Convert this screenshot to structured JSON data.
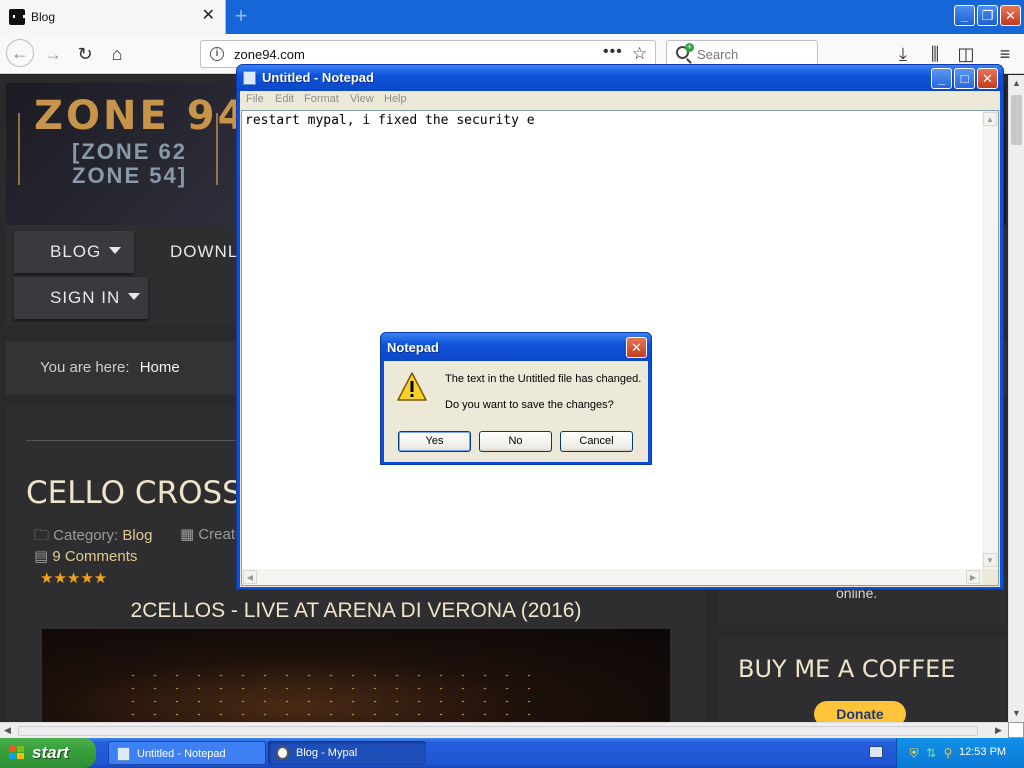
{
  "browser": {
    "tab_title": "Blog",
    "tab_close": "✕",
    "new_tab": "+",
    "url": "zone94.com",
    "url_actions": "•••",
    "search_placeholder": "Search",
    "window_buttons": {
      "minimize": "🗕",
      "restore": "🗗",
      "close": "✕"
    }
  },
  "site": {
    "logo": "ZONE 94",
    "logo_sub1": "[ZONE 62",
    "logo_sub2": "ZONE 54]",
    "nav": {
      "blog": "BLOG",
      "downloads": "DOWNLO",
      "signin": "SIGN IN"
    },
    "breadcrumb_prefix": "You are here:",
    "breadcrumb_home": "Home",
    "article_title": "CELLO CROSSOV",
    "category_label": "Category:",
    "category_value": "Blog",
    "created_label": "Create",
    "comments": "9 Comments",
    "rating_stars": "★★★★★",
    "video_title": "2CELLOS - LIVE AT ARENA DI VERONA (2016)",
    "online_text": "online.",
    "coffee_title": "BUY ME A COFFEE",
    "donate_label": "Donate"
  },
  "notepad": {
    "title": "Untitled - Notepad",
    "menu": [
      "File",
      "Edit",
      "Format",
      "View",
      "Help"
    ],
    "content": "restart mypal, i fixed the security e"
  },
  "dialog": {
    "title": "Notepad",
    "message1": "The text in the Untitled file has changed.",
    "message2": "Do you want to save the changes?",
    "yes": "Yes",
    "no": "No",
    "cancel": "Cancel",
    "close": "✕"
  },
  "taskbar": {
    "start": "start",
    "tasks": [
      "Untitled - Notepad",
      "Blog - Mypal"
    ],
    "clock": "12:53 PM"
  },
  "colors": {
    "xp_blue": "#0c4bd6",
    "start_green": "#36a03a",
    "site_accent": "#e3c98f",
    "star": "#f3a21c"
  }
}
